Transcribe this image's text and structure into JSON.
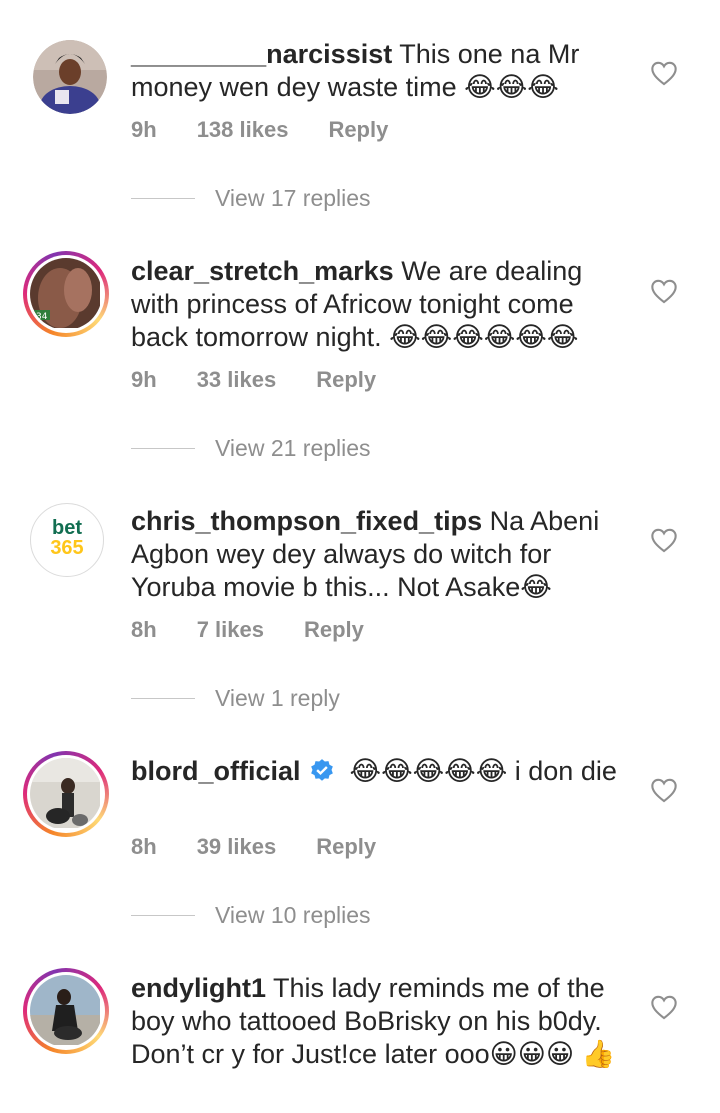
{
  "comments": [
    {
      "username": "_________narcissist",
      "text": "This one na Mr money wen dey waste time 😂😂😂",
      "time": "9h",
      "likes": "138 likes",
      "reply": "Reply",
      "view_replies": "View 17 replies",
      "avatar": "avatar-photo"
    },
    {
      "username": "clear_stretch_marks",
      "text": "We are dealing with princess of Africow tonight come back tomorrow night. 😂😂😂😂😂😂",
      "time": "9h",
      "likes": "33 likes",
      "reply": "Reply",
      "view_replies": "View 21 replies",
      "avatar": "avatar-photo-story-ring"
    },
    {
      "username": "chris_thompson_fixed_tips",
      "text": "Na Abeni Agbon wey dey always do witch for Yoruba movie b this... Not Asake😂",
      "time": "8h",
      "likes": "7 likes",
      "reply": "Reply",
      "view_replies": "View 1 reply",
      "avatar_logo_top": "bet",
      "avatar_logo_bottom": "365"
    },
    {
      "username": "blord_official",
      "text": "😂😂😂😂😂 i don die",
      "time": "8h",
      "likes": "39 likes",
      "reply": "Reply",
      "view_replies": "View 10 replies",
      "verified": true,
      "avatar": "avatar-photo-story-ring"
    },
    {
      "username": "endylight1",
      "text": "This lady reminds me of the boy who tattooed BoBrisky on his b0dy. Don’t cr y for Just!ce later ooo😀😀😀 👍",
      "avatar": "avatar-photo-story-ring"
    }
  ],
  "colors": {
    "text": "#262626",
    "secondary": "#8e8e8e",
    "verified": "#3897f0",
    "bet365_green": "#126e51",
    "bet365_yellow": "#ffdf1b"
  },
  "icons": {
    "like": "heart-outline-icon",
    "verified": "verified-badge-icon"
  }
}
